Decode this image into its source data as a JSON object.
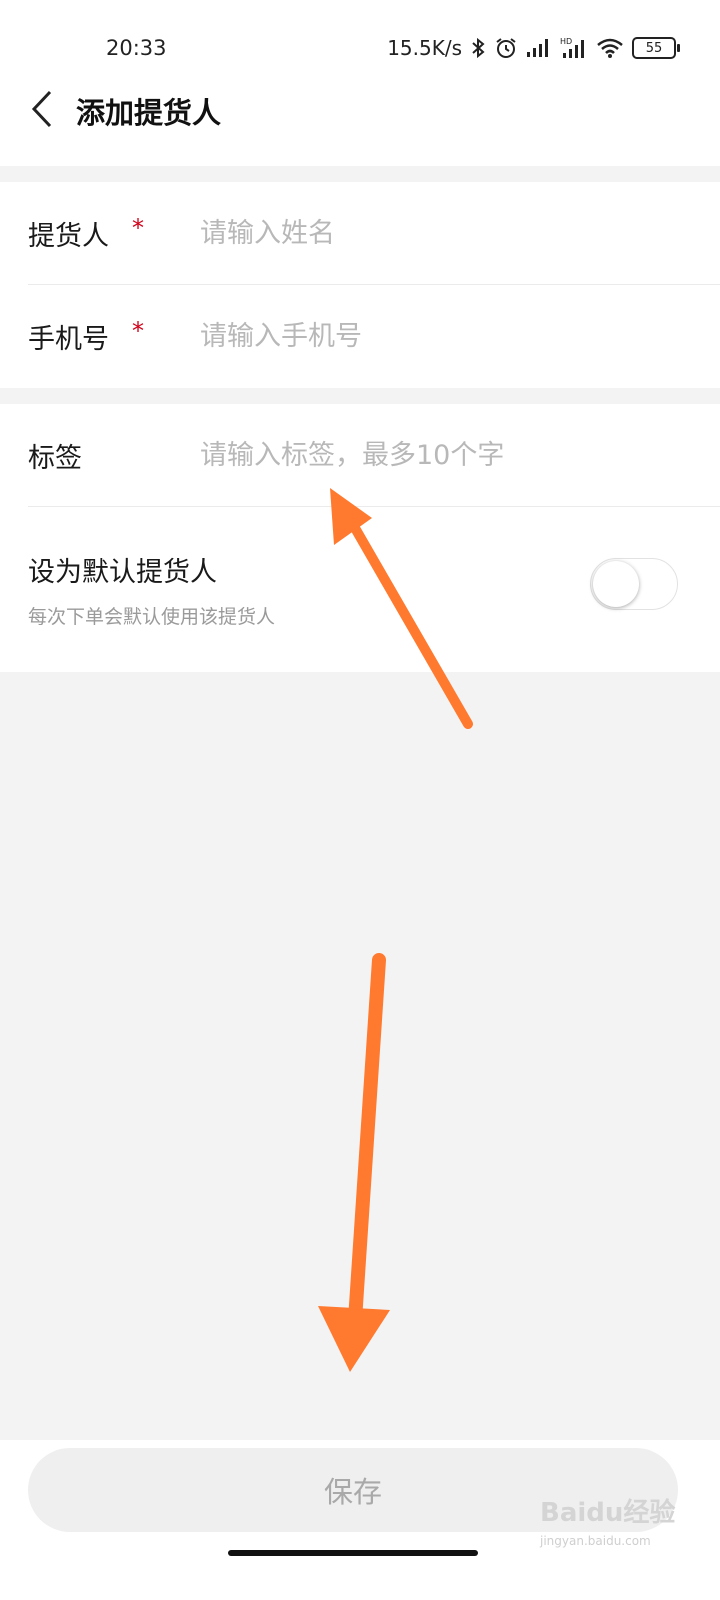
{
  "status_bar": {
    "time": "20:33",
    "net_speed": "15.5K/s",
    "battery": "55"
  },
  "header": {
    "title": "添加提货人"
  },
  "form": {
    "name": {
      "label": "提货人",
      "required_mark": "*",
      "placeholder": "请输入姓名",
      "value": ""
    },
    "phone": {
      "label": "手机号",
      "required_mark": "*",
      "placeholder": "请输入手机号",
      "value": ""
    },
    "tag": {
      "label": "标签",
      "placeholder": "请输入标签，最多10个字",
      "value": ""
    },
    "default_pickup": {
      "title": "设为默认提货人",
      "subtitle": "每次下单会默认使用该提货人",
      "enabled": false
    }
  },
  "footer": {
    "save_label": "保存"
  },
  "watermark": {
    "brand": "Baidu经验",
    "url": "jingyan.baidu.com"
  },
  "colors": {
    "required": "#d0021b",
    "annotation_arrow": "#ff7a2f",
    "background": "#f3f3f3"
  }
}
